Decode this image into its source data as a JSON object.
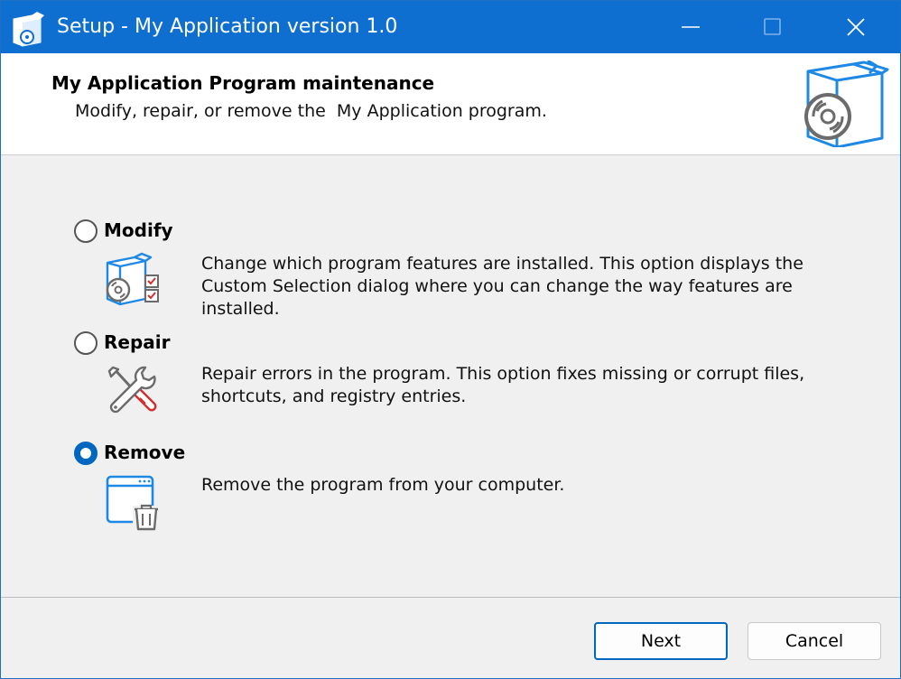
{
  "window": {
    "title": "Setup - My Application version 1.0"
  },
  "header": {
    "title": "My Application Program maintenance",
    "subtitle": "Modify, repair, or remove the  My Application program."
  },
  "options": {
    "modify": {
      "label": "Modify",
      "description": "Change which program features are installed. This option displays the Custom Selection dialog where you can change the way features are installed.",
      "selected": false,
      "icon": "box-checklist-icon"
    },
    "repair": {
      "label": "Repair",
      "description": "Repair errors in the program. This option fixes missing or corrupt files, shortcuts, and registry entries.",
      "selected": false,
      "icon": "wrench-screwdriver-icon"
    },
    "remove": {
      "label": "Remove",
      "description": "Remove the program from your computer.",
      "selected": true,
      "icon": "window-trash-icon"
    }
  },
  "buttons": {
    "next": "Next",
    "cancel": "Cancel"
  },
  "colors": {
    "titlebar": "#0e6fd0",
    "accent": "#0067c0",
    "icon_blue": "#1e88e5",
    "icon_red": "#d32f2f"
  }
}
